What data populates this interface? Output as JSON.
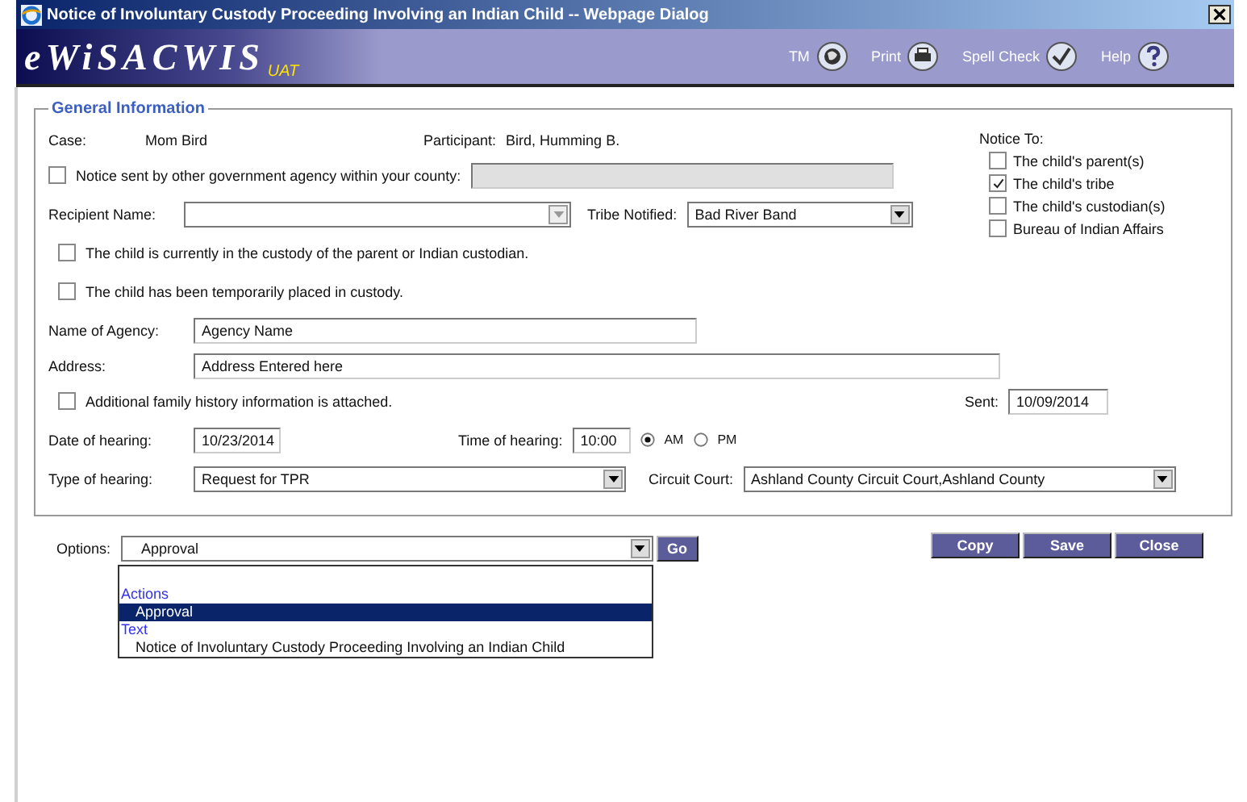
{
  "window": {
    "title": "Notice of Involuntary Custody Proceeding Involving an Indian Child -- Webpage Dialog"
  },
  "header": {
    "logo": "eWiSACWIS",
    "badge": "UAT",
    "tools": [
      {
        "kind": "tm",
        "label": "TM"
      },
      {
        "kind": "print",
        "label": "Print"
      },
      {
        "kind": "spell",
        "label": "Spell Check"
      },
      {
        "kind": "help",
        "label": "Help"
      }
    ]
  },
  "form": {
    "legend": "General Information",
    "case": {
      "label": "Case:",
      "value": "Mom Bird"
    },
    "participant": {
      "label": "Participant:",
      "value": "Bird, Humming B."
    },
    "other_agency": {
      "label": "Notice sent by other government agency within your county:",
      "checked": false,
      "field_disabled": true
    },
    "recipient": {
      "label": "Recipient Name:",
      "disabled": true
    },
    "tribe": {
      "label": "Tribe Notified:",
      "value": "Bad River Band"
    },
    "notice_to": {
      "label": "Notice To:",
      "options": [
        {
          "label": "The child's parent(s)",
          "checked": false
        },
        {
          "label": "The child's tribe",
          "checked": true
        },
        {
          "label": "The child's custodian(s)",
          "checked": false
        },
        {
          "label": "Bureau of Indian Affairs",
          "checked": false
        }
      ]
    },
    "custody": [
      {
        "label": "The child is currently in the custody of the parent or Indian custodian.",
        "checked": false
      },
      {
        "label": "The child has been temporarily placed in custody.",
        "checked": false
      }
    ],
    "agency": {
      "label": "Name of Agency:",
      "value": "Agency Name"
    },
    "address": {
      "label": "Address:",
      "value": "Address Entered here"
    },
    "family_history": {
      "label": "Additional family history information is attached.",
      "checked": false
    },
    "sent": {
      "label": "Sent:",
      "value": "10/09/2014"
    },
    "date": {
      "label": "Date of hearing:",
      "value": "10/23/2014"
    },
    "time": {
      "label": "Time of hearing:",
      "value": "10:00",
      "periods": [
        {
          "label": "AM",
          "selected": true
        },
        {
          "label": "PM",
          "selected": false
        }
      ]
    },
    "type": {
      "label": "Type of hearing:",
      "value": "Request for TPR"
    },
    "court": {
      "label": "Circuit Court:",
      "value": "Ashland County Circuit Court,Ashland County"
    }
  },
  "options": {
    "label": "Options:",
    "value": "Approval",
    "go": "Go",
    "list": [
      {
        "kind": "group",
        "label": "Actions"
      },
      {
        "kind": "option",
        "label": "Approval",
        "selected": true
      },
      {
        "kind": "group",
        "label": "Text"
      },
      {
        "kind": "option",
        "label": "Notice of Involuntary Custody Proceeding Involving an Indian Child",
        "selected": false
      }
    ]
  },
  "buttons": [
    "Copy",
    "Save",
    "Close"
  ]
}
